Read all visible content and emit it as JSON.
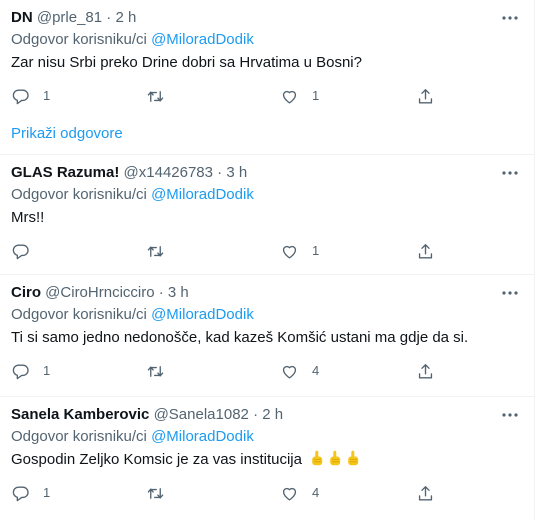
{
  "tweets": [
    {
      "name": "DN",
      "handle": "@prle_81",
      "dot": "·",
      "time": "2 h",
      "reply_prefix": "Odgovor korisniku/ci ",
      "reply_mention": "@MiloradDodik",
      "text": "Zar nisu Srbi preko Drine dobri sa Hrvatima u Bosni?",
      "reply_count": "1",
      "retweet_count": "",
      "like_count": "1",
      "show_replies": "Prikaži odgovore"
    },
    {
      "name": "GLAS Razuma!",
      "handle": "@x14426783",
      "dot": "·",
      "time": "3 h",
      "reply_prefix": "Odgovor korisniku/ci ",
      "reply_mention": "@MiloradDodik",
      "text": "Mrs!!",
      "reply_count": "",
      "retweet_count": "",
      "like_count": "1"
    },
    {
      "name": "Ciro",
      "handle": "@CiroHrncicciro",
      "dot": "·",
      "time": "3 h",
      "reply_prefix": "Odgovor korisniku/ci ",
      "reply_mention": "@MiloradDodik",
      "text": "Ti si samo jedno nedonošče, kad kazeš Komšić ustani ma gdje da si.",
      "reply_count": "1",
      "retweet_count": "",
      "like_count": "4"
    },
    {
      "name": "Sanela Kamberovic",
      "handle": "@Sanela1082",
      "dot": "·",
      "time": "2 h",
      "reply_prefix": "Odgovor korisniku/ci ",
      "reply_mention": "@MiloradDodik",
      "text": "Gospodin Zeljko Komsic je za vas institucija",
      "emoji": [
        "pointing-up-emoji",
        "pointing-up-emoji",
        "pointing-up-emoji"
      ],
      "reply_count": "1",
      "retweet_count": "",
      "like_count": "4"
    }
  ],
  "icons": {
    "more": "more-dots-icon",
    "reply": "reply-icon",
    "retweet": "retweet-icon",
    "like": "heart-icon",
    "share": "share-icon"
  },
  "colors": {
    "text": "#0f1419",
    "secondary": "#536471",
    "accent": "#1d9bf0",
    "divider": "#eff3f4",
    "emoji": "#f5c518"
  }
}
